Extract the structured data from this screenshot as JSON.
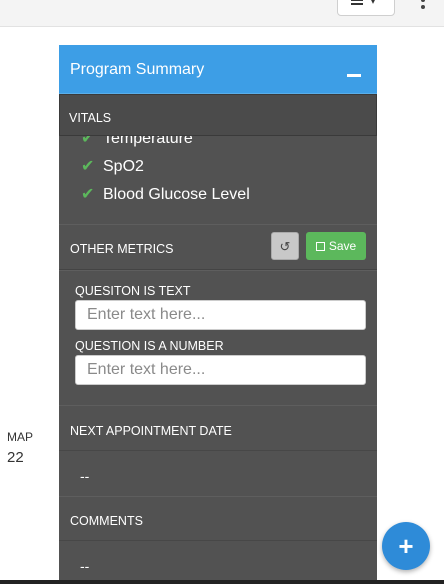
{
  "topbar": {
    "dropdown_icon": "menu-bars-icon",
    "more_icon": "kebab-icon"
  },
  "left": {
    "label": "MAP",
    "value": "22"
  },
  "panel": {
    "title": "Program Summary",
    "collapse_icon": "minus-icon",
    "vitals": {
      "heading": "VITALS",
      "items": [
        "Temperature",
        "SpO2",
        "Blood Glucose Level"
      ]
    },
    "other_metrics": {
      "heading": "OTHER METRICS",
      "reset_icon": "undo-icon",
      "save_label": "Save"
    },
    "questions": [
      {
        "label": "QUESITON IS TEXT",
        "placeholder": "Enter text here..."
      },
      {
        "label": "QUESTION IS A NUMBER",
        "placeholder": "Enter text here..."
      }
    ],
    "next_appointment": {
      "label": "NEXT APPOINTMENT DATE",
      "value": "--"
    },
    "comments": {
      "label": "COMMENTS",
      "value": "--"
    }
  },
  "fab": {
    "label": "+"
  },
  "colors": {
    "header": "#3d9ee6",
    "panel": "#525252",
    "save": "#5cb85c",
    "fab": "#2e8bd8"
  }
}
